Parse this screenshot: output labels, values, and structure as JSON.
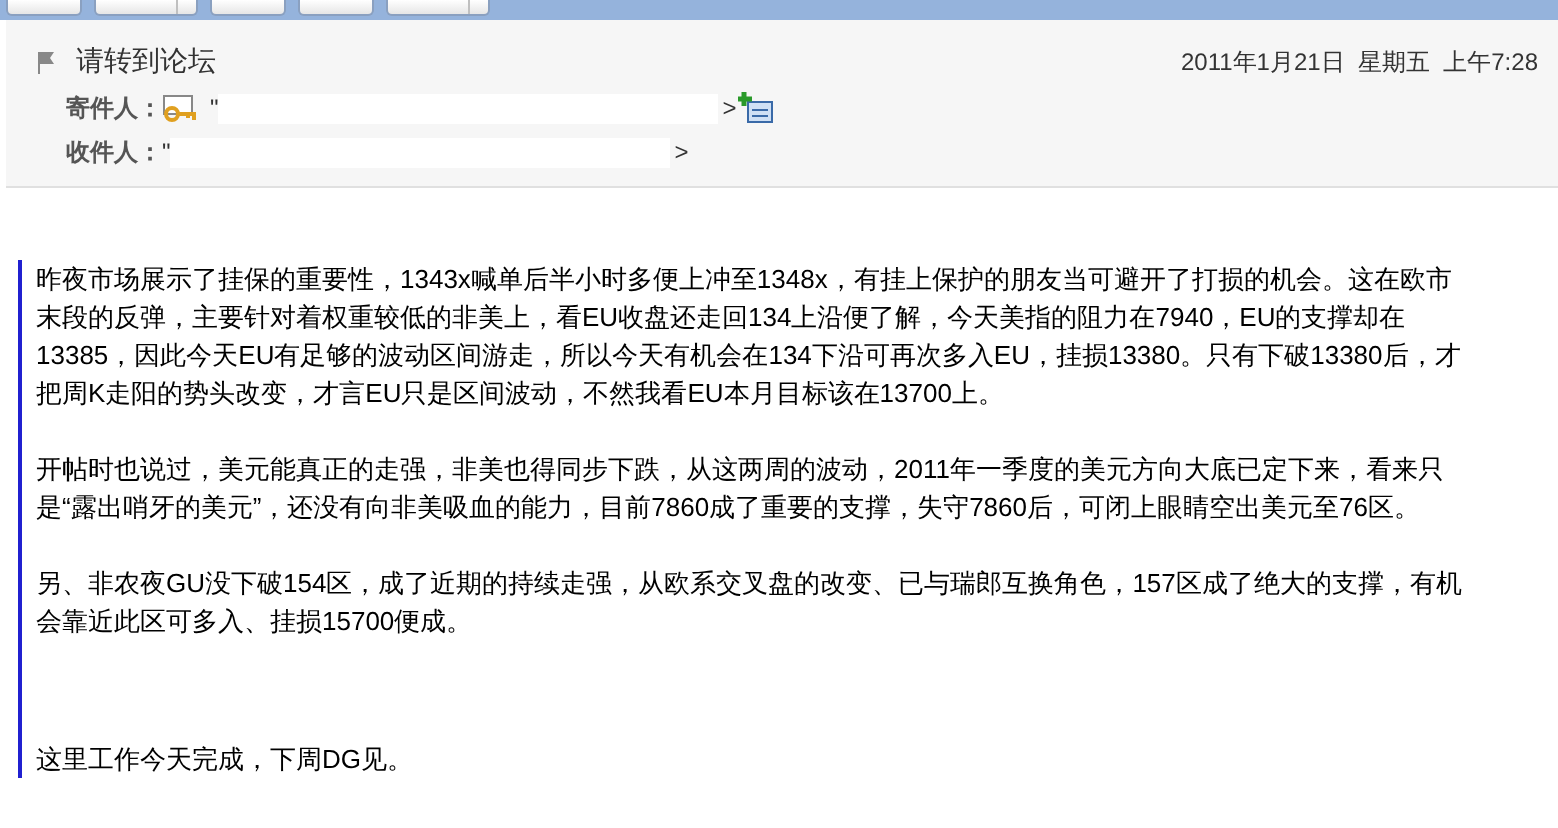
{
  "toolbar": {
    "buttons": [
      {
        "kind": "plain"
      },
      {
        "kind": "split"
      },
      {
        "kind": "plain"
      },
      {
        "kind": "plain"
      },
      {
        "kind": "split"
      }
    ]
  },
  "header": {
    "subject": "请转到论坛",
    "date": "2011年1月21日  星期五  上午7:28",
    "from": {
      "label": "寄件人：",
      "prefix": "\"",
      "suffix": ">"
    },
    "to": {
      "label": "收件人：",
      "prefix": "\"",
      "suffix": ">"
    }
  },
  "body": {
    "paragraphs": [
      "昨夜市场展示了挂保的重要性，1343x喊单后半小时多便上冲至1348x，有挂上保护的朋友当可避开了打损的机会。这在欧市末段的反弹，主要针对着权重较低的非美上，看EU收盘还走回134上沿便了解，今天美指的阻力在7940，EU的支撑却在13385，因此今天EU有足够的波动区间游走，所以今天有机会在134下沿可再次多入EU，挂损13380。只有下破13380后，才把周K走阳的势头改变，才言EU只是区间波动，不然我看EU本月目标该在13700上。",
      "开帖时也说过，美元能真正的走强，非美也得同步下跌，从这两周的波动，2011年一季度的美元方向大底已定下来，看来只是“露出哨牙的美元”，还没有向非美吸血的能力，目前7860成了重要的支撑，失守7860后，可闭上眼睛空出美元至76区。",
      "另、非农夜GU没下破154区，成了近期的持续走强，从欧系交叉盘的改变、已与瑞郎互换角色，157区成了绝大的支撑，有机会靠近此区可多入、挂损15700便成。",
      "这里工作今天完成，下周DG见。"
    ]
  }
}
